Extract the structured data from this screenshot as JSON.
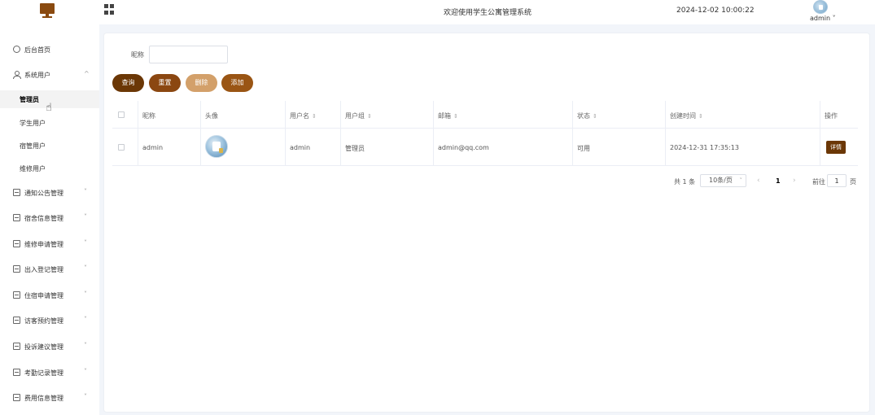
{
  "header": {
    "welcome": "欢迎使用学生公寓管理系统",
    "datetime": "2024-12-02 10:00:22",
    "user_menu": "admin ˅"
  },
  "sidebar": {
    "home": "后台首页",
    "system_users": "系统用户",
    "sub_items": [
      "管理员",
      "学生用户",
      "宿管用户",
      "维修用户"
    ],
    "menus": [
      "通知公告管理",
      "宿舍信息管理",
      "维修申请管理",
      "出入登记管理",
      "住宿申请管理",
      "访客预约管理",
      "投诉建议管理",
      "考勤记录管理",
      "费用信息管理"
    ]
  },
  "search": {
    "label": "昵称",
    "value": ""
  },
  "toolbar": {
    "query": "查询",
    "reset": "重置",
    "delete": "删除",
    "add": "添加"
  },
  "table": {
    "columns": [
      "昵称",
      "头像",
      "用户名",
      "用户组",
      "邮箱",
      "状态",
      "创建时间",
      "操作"
    ],
    "rows": [
      {
        "nickname": "admin",
        "username": "admin",
        "group": "管理员",
        "email": "admin@qq.com",
        "status": "可用",
        "created": "2024-12-31 17:35:13",
        "action": "详情"
      }
    ]
  },
  "pagination": {
    "total": "共 1 条",
    "page_size": "10条/页",
    "current_page": "1",
    "goto_label": "前往",
    "goto_value": "1",
    "page_unit": "页"
  }
}
